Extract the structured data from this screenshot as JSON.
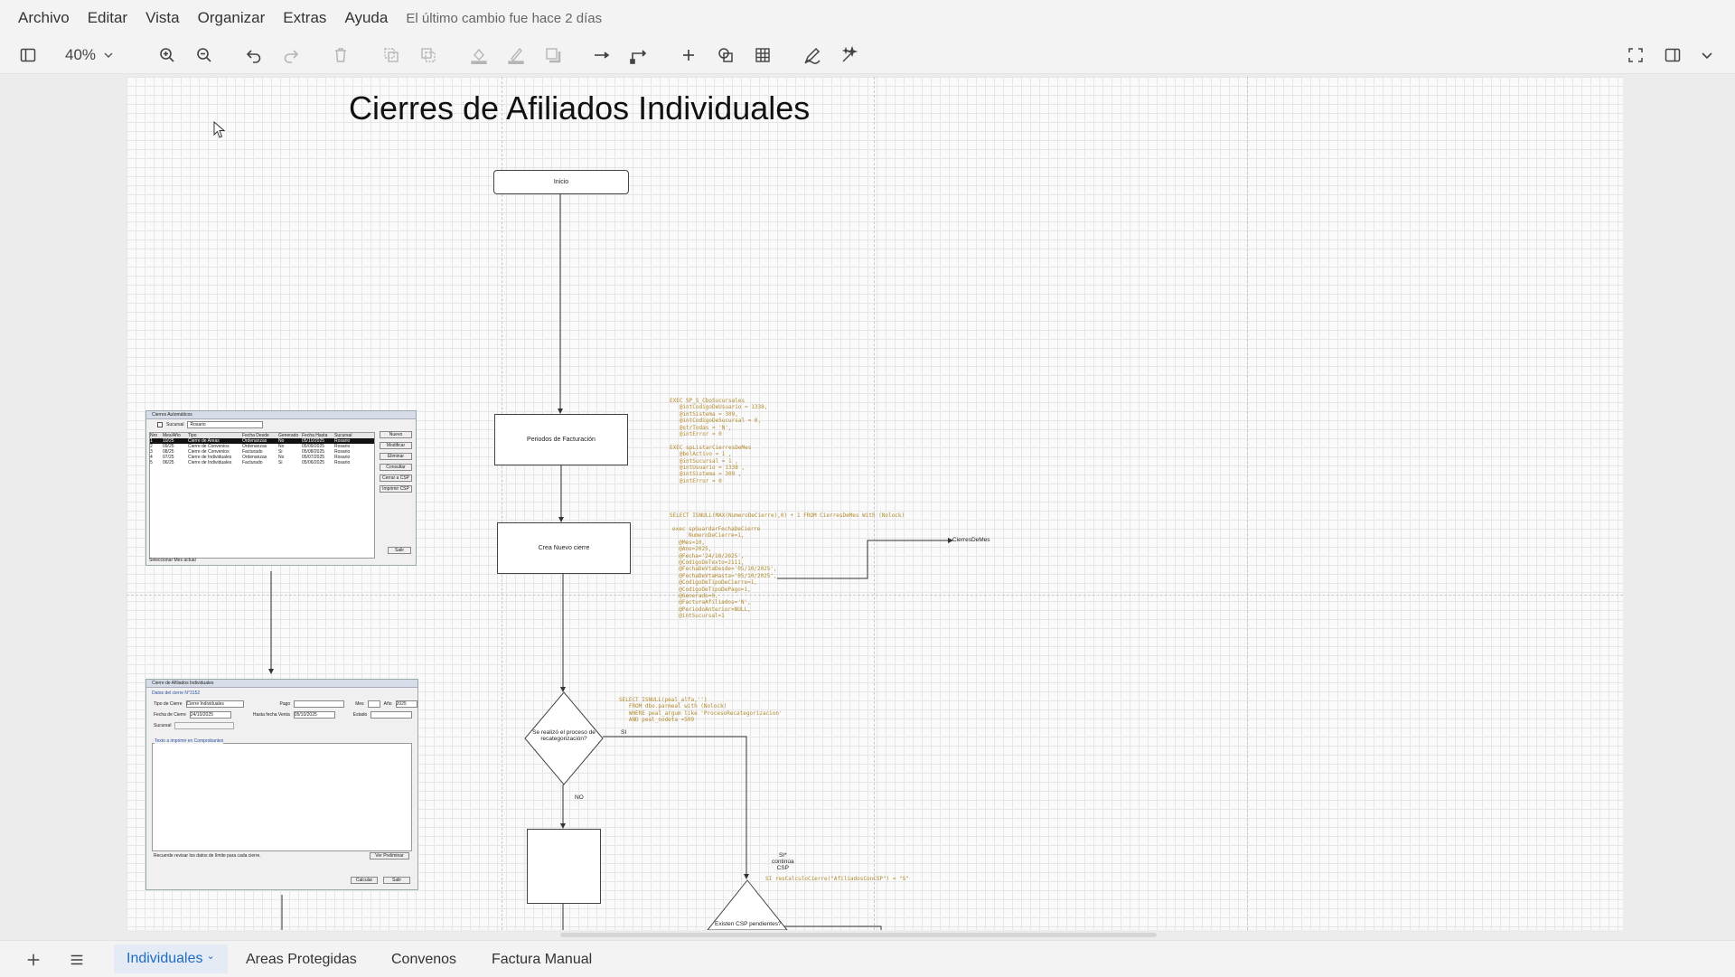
{
  "menubar": {
    "items": [
      "Archivo",
      "Editar",
      "Vista",
      "Organizar",
      "Extras",
      "Ayuda"
    ],
    "last_change": "El último cambio fue hace 2 días"
  },
  "toolbar": {
    "zoom_value": "40%",
    "icons": [
      "sidebar-toggle-icon",
      "zoom-in-icon",
      "zoom-out-icon",
      "undo-icon",
      "redo-icon",
      "delete-icon",
      "to-front-icon",
      "to-back-icon",
      "fill-color-icon",
      "line-color-icon",
      "shadow-icon",
      "connection-icon",
      "waypoints-icon",
      "insert-icon",
      "shapes-icon",
      "table-icon",
      "freehand-icon",
      "ai-generate-icon",
      "fullscreen-icon",
      "format-panel-icon",
      "collapse-icon"
    ]
  },
  "diagram": {
    "title": "Cierres de Afiliados Individuales",
    "nodes": {
      "inicio": "Inicio",
      "periodos": "Periodos de Facturación",
      "crea_cierre": "Crea Nuevo cierre",
      "decision_recat": "Se realizó el proceso de recategorización?",
      "decision_csp": "Existen CSP pendientes?",
      "label_no": "NO",
      "label_si": "SI",
      "label_si2": "SI*",
      "cierres_label": "CierresDeMes",
      "csp_note": "SI*\ncontinúa\nCSP"
    },
    "code": {
      "block1": "EXEC SP_S_CboSucursales\n   @intCodigoDeUsuario = 1338,\n   @intSistema = 309,\n   @intCodigoDeSucursal = 0,\n   @strTodas = 'N',\n   @intError = 0\n\nEXEC spListarCierresDeMes\n   @bolActivo = 1 ,\n   @intSucursal = 1 ,\n   @intUsuario = 1338 ,\n   @intSistema = 309 ,\n   @intError = 0",
      "block2": "SELECT ISNULL(MAX(NumeroDeCierre),0) + 1 FROM CierresDeMes With (Nolock)",
      "block3": "exec spGuardarFechaDeCierre\n     NumeroDeCierre=1,\n  @Mes=10,\n  @Ano=2025,\n  @Fecha='24/10/2025',\n  @CodigoDeTexto=2111,\n  @FechaDeVtaDesde='05/10/2025',\n  @FechaDeVtaHasta='05/10/2025',\n  @CodigoDeTipoDeCierre=1,\n  @CodigoDeTipoDePago=1,\n  @Generado=0,\n  @FacturaAfiliados='N',\n  @PeriodoAnterior=NULL,\n  @intSucursal=1",
      "block4": "SELECT ISNULL(peal_alfa,'')\n   FROM dbo.parmeal with (Nolock)\n   WHERE peal_argum like 'ProcesoRecategorizacion'\n   AND peal_nodeta =509",
      "block5": "SI resCalculoCierre(\"AfiliadosConCSP\") = \"S\""
    },
    "embedded_window_1": {
      "title": "Cierres Automáticos",
      "sucursal_label": "Sucursal",
      "sucursal_value": "Rosario",
      "columns": [
        "Nro",
        "Mes/Año",
        "Tipo",
        "Fecha Desde",
        "Generado",
        "Fecha Hasta",
        "Sucursal"
      ],
      "rows": [
        [
          "1",
          "10/25",
          "Cierre de Areas Protegidas",
          "Ordenanzas",
          "No",
          "05/10/2025",
          "Rosario"
        ],
        [
          "2",
          "09/25",
          "Cierre de Convenios",
          "Ordenanzas",
          "No",
          "05/09/2025",
          "Rosario"
        ],
        [
          "3",
          "08/25",
          "Cierre de Convenios",
          "Facturado",
          "Si",
          "05/08/2025",
          "Rosario"
        ],
        [
          "4",
          "07/25",
          "Cierre de Individuales",
          "Ordenanzas",
          "No",
          "05/07/2025",
          "Rosario"
        ],
        [
          "5",
          "06/25",
          "Cierre de Individuales",
          "Facturado",
          "Si",
          "05/06/2025",
          "Rosario"
        ]
      ],
      "buttons": [
        "Nuevo",
        "Modificar",
        "Eliminar",
        "Consultar",
        "Cerrar a CSP",
        "Imprimir CSP",
        "Salir"
      ],
      "footer_check": "Seleccionar Mes actual"
    },
    "embedded_window_2": {
      "title": "Cierre de Afiliados Individuales",
      "group": "Datos del cierre N°3152",
      "tipo_label": "Tipo de Cierre",
      "tipo_value": "Cierre Individuales",
      "pago_label": "Pago",
      "mes_label": "Mes",
      "ano_label": "Año",
      "ano_value": "2025",
      "fecha_label": "Fecha de Cierre",
      "fecha_value": "24/10/2025",
      "hasta_label": "Hasta fecha Venta",
      "hasta_value": "05/10/2025",
      "estado_label": "Estado",
      "sucursal_label": "Sucursal",
      "textarea_label": "Texto a imprimir en Comprobantes",
      "footer_text": "Recuerde revisar los datos de límite para cada cierre.",
      "footer_btn": "Ver Preliminar",
      "buttons": [
        "Calcular",
        "Salir"
      ]
    }
  },
  "tabs": {
    "items": [
      "Individuales",
      "Areas Protegidas",
      "Convenos",
      "Factura Manual"
    ],
    "active": "Individuales"
  }
}
